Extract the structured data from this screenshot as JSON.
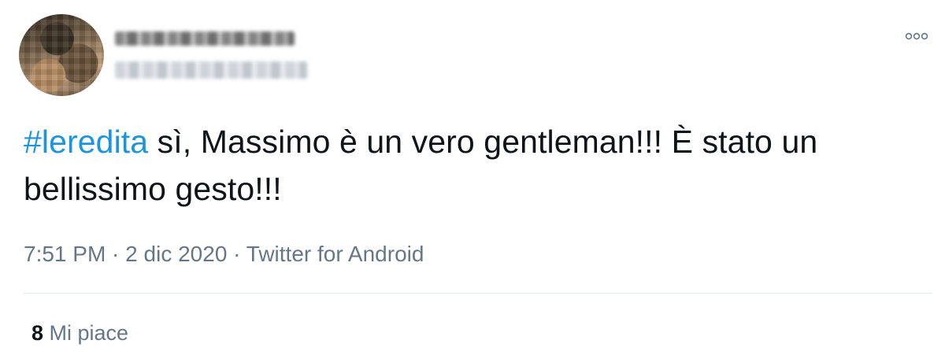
{
  "tweet": {
    "hashtag": "#leredita",
    "body_text": " sì, Massimo è un vero gentleman!!! È stato un bellissimo gesto!!!",
    "time": "7:51 PM",
    "separator": " · ",
    "date": "2 dic 2020",
    "source": "Twitter for Android",
    "likes_count": "8",
    "likes_label": " Mi piace",
    "more_icon": "more-horizontal-icon"
  },
  "colors": {
    "hashtag": "#1b95e0",
    "text": "#0f1419",
    "meta": "#657786",
    "divider": "#e1e8ed"
  }
}
